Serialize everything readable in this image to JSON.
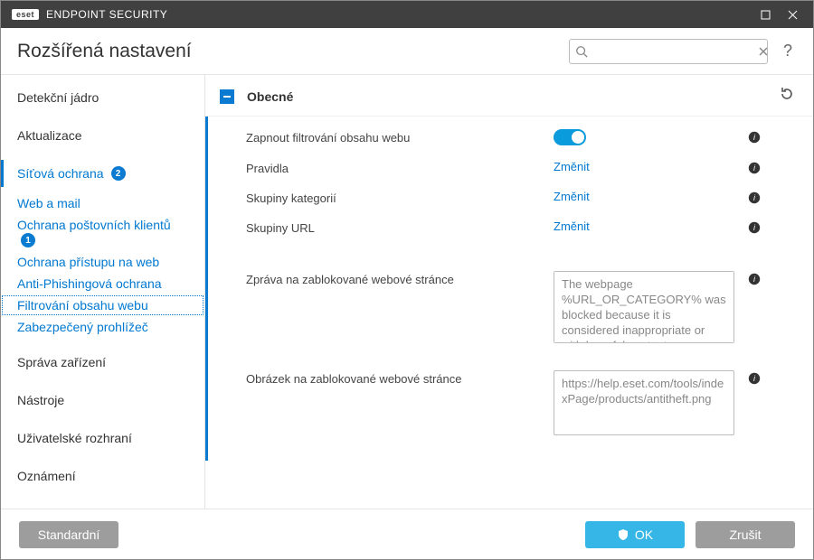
{
  "titlebar": {
    "brand_short": "eset",
    "brand_text": "ENDPOINT SECURITY"
  },
  "header": {
    "title": "Rozšířená nastavení",
    "search_placeholder": "",
    "help": "?"
  },
  "sidebar": {
    "items": [
      {
        "label": "Detekční jádro",
        "type": "top"
      },
      {
        "label": "Aktualizace",
        "type": "top"
      },
      {
        "label": "Síťová ochrana",
        "type": "top",
        "selected": true,
        "badge": "2"
      },
      {
        "label": "Web a mail",
        "type": "sub"
      },
      {
        "label": "Ochrana poštovních klientů",
        "type": "sub",
        "badge": "1"
      },
      {
        "label": "Ochrana přístupu na web",
        "type": "sub"
      },
      {
        "label": "Anti-Phishingová ochrana",
        "type": "sub"
      },
      {
        "label": "Filtrování obsahu webu",
        "type": "sub",
        "active": true
      },
      {
        "label": "Zabezpečený prohlížeč",
        "type": "sub"
      },
      {
        "label": "Správa zařízení",
        "type": "top"
      },
      {
        "label": "Nástroje",
        "type": "top"
      },
      {
        "label": "Uživatelské rozhraní",
        "type": "top"
      },
      {
        "label": "Oznámení",
        "type": "top"
      }
    ]
  },
  "main": {
    "section_title": "Obecné",
    "rows": {
      "enable_filter_label": "Zapnout filtrování obsahu webu",
      "rules_label": "Pravidla",
      "rules_action": "Změnit",
      "cat_groups_label": "Skupiny kategorií",
      "cat_groups_action": "Změnit",
      "url_groups_label": "Skupiny URL",
      "url_groups_action": "Změnit",
      "blocked_msg_label": "Zpráva na zablokované webové stránce",
      "blocked_msg_value": "The webpage %URL_OR_CATEGORY% was blocked because it is considered inappropriate or with harmful content.",
      "blocked_img_label": "Obrázek na zablokované webové stránce",
      "blocked_img_value": "https://help.eset.com/tools/indexPage/products/antitheft.png"
    }
  },
  "footer": {
    "default_label": "Standardní",
    "ok_label": "OK",
    "cancel_label": "Zrušit"
  }
}
